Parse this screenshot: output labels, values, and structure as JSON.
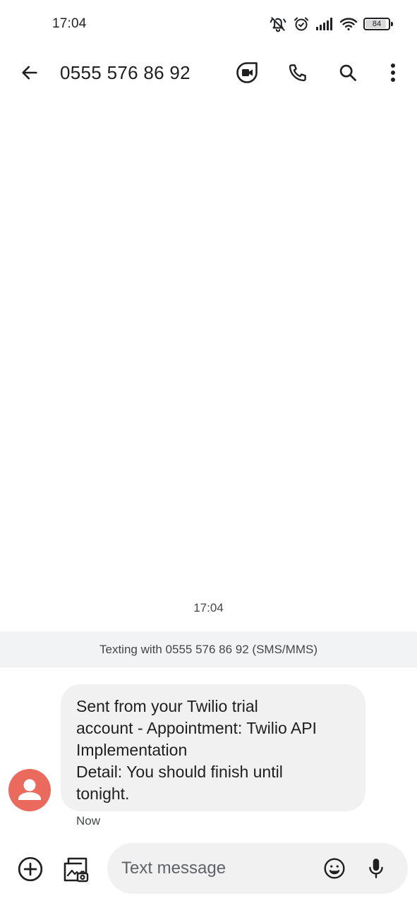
{
  "status_bar": {
    "time": "17:04",
    "battery_level": "84",
    "battery_fraction": 0.84,
    "icons": [
      "silent-icon",
      "alarm-icon",
      "signal-icon",
      "wifi-icon",
      "battery-icon"
    ]
  },
  "header": {
    "contact": "0555 576 86 92",
    "icons": [
      "back-arrow-icon",
      "video-call-icon",
      "phone-icon",
      "search-icon",
      "more-vert-icon"
    ]
  },
  "conversation": {
    "timestamp": "17:04",
    "banner": "Texting with 0555 576 86 92 (SMS/MMS)",
    "message": {
      "lines": [
        "Sent from your Twilio trial",
        "account - Appointment: Twilio API",
        "Implementation",
        "Detail: You should finish until",
        "tonight."
      ],
      "status": "Now"
    }
  },
  "compose": {
    "placeholder": "Text message",
    "value": "",
    "icons": [
      "add-circle-icon",
      "gallery-icon",
      "emoji-icon",
      "mic-icon"
    ]
  },
  "colors": {
    "avatar": "#ea6b5e",
    "bubble": "#f1f1f1",
    "banner": "#f1f3f4",
    "text": "#1f1f1f"
  }
}
